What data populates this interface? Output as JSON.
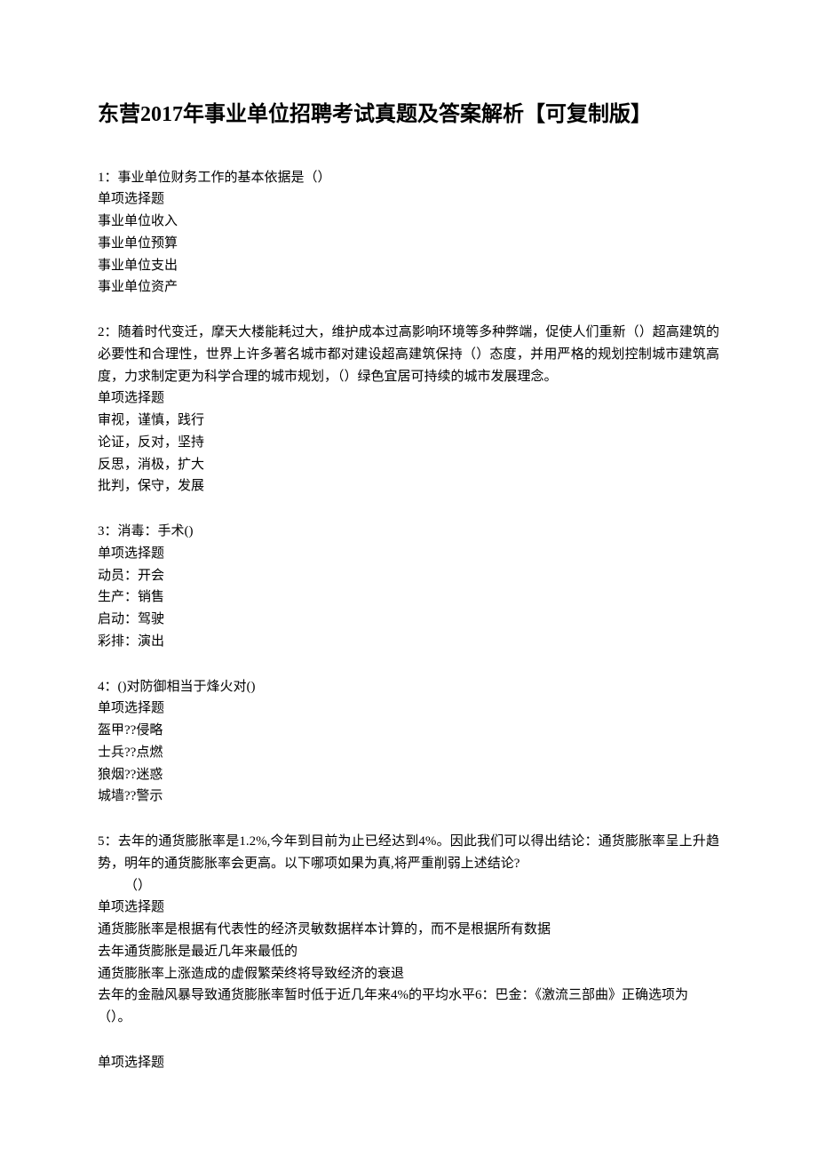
{
  "title": "东营2017年事业单位招聘考试真题及答案解析【可复制版】",
  "questions": [
    {
      "stem": "1：事业单位财务工作的基本依据是（）",
      "type": "单项选择题",
      "options": [
        "事业单位收入",
        "事业单位预算",
        "事业单位支出",
        "事业单位资产"
      ]
    },
    {
      "stem": "2：随着时代变迁，摩天大楼能耗过大，维护成本过高影响环境等多种弊端，促使人们重新（）超高建筑的必要性和合理性，世界上许多著名城市都对建设超高建筑保持（）态度，并用严格的规划控制城市建筑高度，力求制定更为科学合理的城市规划，（）绿色宜居可持续的城市发展理念。",
      "type": "单项选择题",
      "options": [
        "审视，谨慎，践行",
        "论证，反对，坚持",
        "反思，消极，扩大",
        "批判，保守，发展"
      ]
    },
    {
      "stem": "3：消毒：手术()",
      "type": "单项选择题",
      "options": [
        "动员：开会",
        "生产：销售",
        "启动：驾驶",
        "彩排：演出"
      ]
    },
    {
      "stem": "4：()对防御相当于烽火对()",
      "type": "单项选择题",
      "options": [
        "盔甲??侵略",
        "士兵??点燃",
        "狼烟??迷惑",
        "城墙??警示"
      ]
    },
    {
      "stem": "5：去年的通货膨胀率是1.2%,今年到目前为止已经达到4%。因此我们可以得出结论：通货膨胀率呈上升趋势，明年的通货膨胀率会更高。以下哪项如果为真,将严重削弱上述结论?",
      "stem_tail": "（）",
      "type": "单项选择题",
      "options": [
        "通货膨胀率是根据有代表性的经济灵敏数据样本计算的，而不是根据所有数据",
        "去年通货膨胀是最近几年来最低的",
        "通货膨胀率上涨造成的虚假繁荣终将导致经济的衰退",
        "去年的金融风暴导致通货膨胀率暂时低于近几年来4%的平均水平6：巴金：《激流三部曲》正确选项为（）。"
      ],
      "trailing_type": "单项选择题"
    }
  ]
}
